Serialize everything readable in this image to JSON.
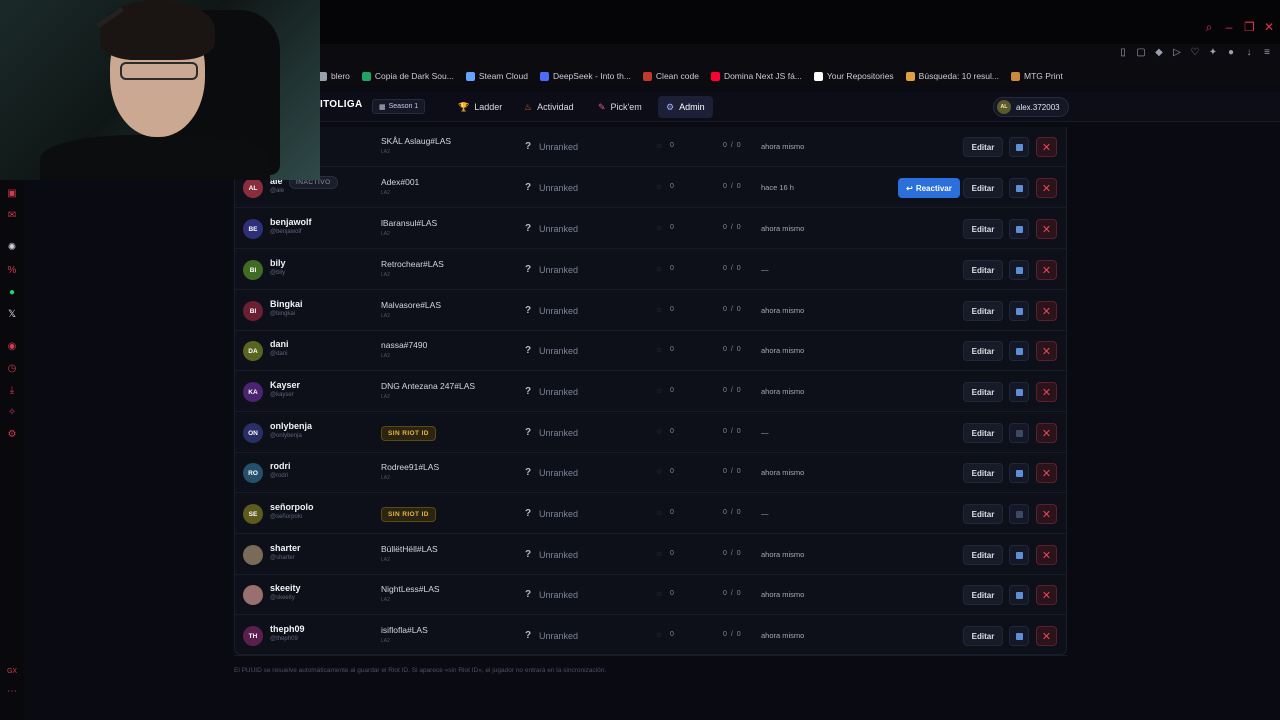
{
  "browser": {
    "bookmarks": [
      {
        "label": "blero",
        "icon": "generic-icon",
        "color": "#9aa0ad"
      },
      {
        "label": "Copia de Dark Sou...",
        "icon": "sheets-icon",
        "color": "#1fa463"
      },
      {
        "label": "Steam Cloud",
        "icon": "steam-icon",
        "color": "#66a3ff"
      },
      {
        "label": "DeepSeek - Into th...",
        "icon": "deepseek-icon",
        "color": "#4d6bfe"
      },
      {
        "label": "Clean code",
        "icon": "book-icon",
        "color": "#c0392b"
      },
      {
        "label": "Domina Next JS fá...",
        "icon": "youtube-icon",
        "color": "#ff0033"
      },
      {
        "label": "Your Repositories",
        "icon": "github-icon",
        "color": "#ffffff"
      },
      {
        "label": "Búsqueda: 10 resul...",
        "icon": "search-site-icon",
        "color": "#e0a040"
      },
      {
        "label": "MTG Print",
        "icon": "card-icon",
        "color": "#c98a3a"
      }
    ]
  },
  "nav": {
    "brand": "ITOLIGA",
    "season": "Season 1",
    "tabs": [
      {
        "label": "Ladder",
        "icon": "trophy-icon",
        "color": "#e0a83a"
      },
      {
        "label": "Actividad",
        "icon": "flame-icon",
        "color": "#e4683a"
      },
      {
        "label": "Pick'em",
        "icon": "pickem-icon",
        "color": "#d85f8c"
      },
      {
        "label": "Admin",
        "icon": "gear-icon",
        "color": "#9fb0ff"
      }
    ],
    "user": {
      "initials": "AL",
      "name": "alex.372003"
    }
  },
  "players": [
    {
      "name": "",
      "handle": "",
      "initials": "",
      "avatar_color": "",
      "riot_id": "SKÅL Aslaug#LAS",
      "region": "LA2",
      "rank": "Unranked",
      "points": "0",
      "games": "0 / 0",
      "last": "ahora mismo",
      "inactive": false,
      "no_riot": false,
      "sync_dim": false
    },
    {
      "name": "ale",
      "handle": "@ale",
      "initials": "AL",
      "avatar_color": "#8a2e3e",
      "riot_id": "Adex#001",
      "region": "LA2",
      "rank": "Unranked",
      "points": "0",
      "games": "0 / 0",
      "last": "hace 16 h",
      "inactive": true,
      "no_riot": false,
      "sync_dim": false
    },
    {
      "name": "benjawolf",
      "handle": "@benjawolf",
      "initials": "BE",
      "avatar_color": "#2d2f7a",
      "riot_id": "lBaransul#LAS",
      "region": "LA2",
      "rank": "Unranked",
      "points": "0",
      "games": "0 / 0",
      "last": "ahora mismo",
      "inactive": false,
      "no_riot": false,
      "sync_dim": false
    },
    {
      "name": "bily",
      "handle": "@bily",
      "initials": "BI",
      "avatar_color": "#3f6b24",
      "riot_id": "Retrochear#LAS",
      "region": "LA2",
      "rank": "Unranked",
      "points": "0",
      "games": "0 / 0",
      "last": "—",
      "inactive": false,
      "no_riot": false,
      "sync_dim": false
    },
    {
      "name": "Bingkai",
      "handle": "@bingkai",
      "initials": "BI",
      "avatar_color": "#6b1f33",
      "riot_id": "Malvasore#LAS",
      "region": "LA2",
      "rank": "Unranked",
      "points": "0",
      "games": "0 / 0",
      "last": "ahora mismo",
      "inactive": false,
      "no_riot": false,
      "sync_dim": false
    },
    {
      "name": "dani",
      "handle": "@dani",
      "initials": "DA",
      "avatar_color": "#5a6421",
      "riot_id": "nassa#7490",
      "region": "LA2",
      "rank": "Unranked",
      "points": "0",
      "games": "0 / 0",
      "last": "ahora mismo",
      "inactive": false,
      "no_riot": false,
      "sync_dim": false
    },
    {
      "name": "Kayser",
      "handle": "@kayser",
      "initials": "KA",
      "avatar_color": "#4a2470",
      "riot_id": "DNG Antezana 247#LAS",
      "region": "LA2",
      "rank": "Unranked",
      "points": "0",
      "games": "0 / 0",
      "last": "ahora mismo",
      "inactive": false,
      "no_riot": false,
      "sync_dim": false
    },
    {
      "name": "onlybenja",
      "handle": "@onlybenja",
      "initials": "ON",
      "avatar_color": "#2a2e66",
      "riot_id": "",
      "region": "",
      "rank": "Unranked",
      "points": "0",
      "games": "0 / 0",
      "last": "—",
      "inactive": false,
      "no_riot": true,
      "sync_dim": true
    },
    {
      "name": "rodri",
      "handle": "@rodri",
      "initials": "RO",
      "avatar_color": "#24506b",
      "riot_id": "Rodree91#LAS",
      "region": "LA2",
      "rank": "Unranked",
      "points": "0",
      "games": "0 / 0",
      "last": "ahora mismo",
      "inactive": false,
      "no_riot": false,
      "sync_dim": false
    },
    {
      "name": "señorpolo",
      "handle": "@señorpolo",
      "initials": "SE",
      "avatar_color": "#5c5a1c",
      "riot_id": "",
      "region": "",
      "rank": "Unranked",
      "points": "0",
      "games": "0 / 0",
      "last": "—",
      "inactive": false,
      "no_riot": true,
      "sync_dim": true
    },
    {
      "name": "sharter",
      "handle": "@sharter",
      "initials": "",
      "avatar_color": "#7a6a5a",
      "riot_id": "BüllëtHëll#LAS",
      "region": "LA2",
      "rank": "Unranked",
      "points": "0",
      "games": "0 / 0",
      "last": "ahora mismo",
      "inactive": false,
      "no_riot": false,
      "sync_dim": false
    },
    {
      "name": "skeeity",
      "handle": "@skeeity",
      "initials": "",
      "avatar_color": "#9a6f6f",
      "riot_id": "NightLess#LAS",
      "region": "LA2",
      "rank": "Unranked",
      "points": "0",
      "games": "0 / 0",
      "last": "ahora mismo",
      "inactive": false,
      "no_riot": false,
      "sync_dim": false
    },
    {
      "name": "theph09",
      "handle": "@theph09",
      "initials": "TH",
      "avatar_color": "#5a1f4f",
      "riot_id": "isiflofla#LAS",
      "region": "LA2",
      "rank": "Unranked",
      "points": "0",
      "games": "0 / 0",
      "last": "ahora mismo",
      "inactive": false,
      "no_riot": false,
      "sync_dim": false
    }
  ],
  "labels": {
    "inactive": "INACTIVO",
    "no_riot": "SIN RIOT ID",
    "edit": "Editar",
    "reactivate": "Reactivar",
    "delete": "✕"
  },
  "footer": "El PUUID se resuelve automáticamente al guardar el Riot ID. Si aparece «sin Riot ID», el jugador no entrará en la sincronización."
}
